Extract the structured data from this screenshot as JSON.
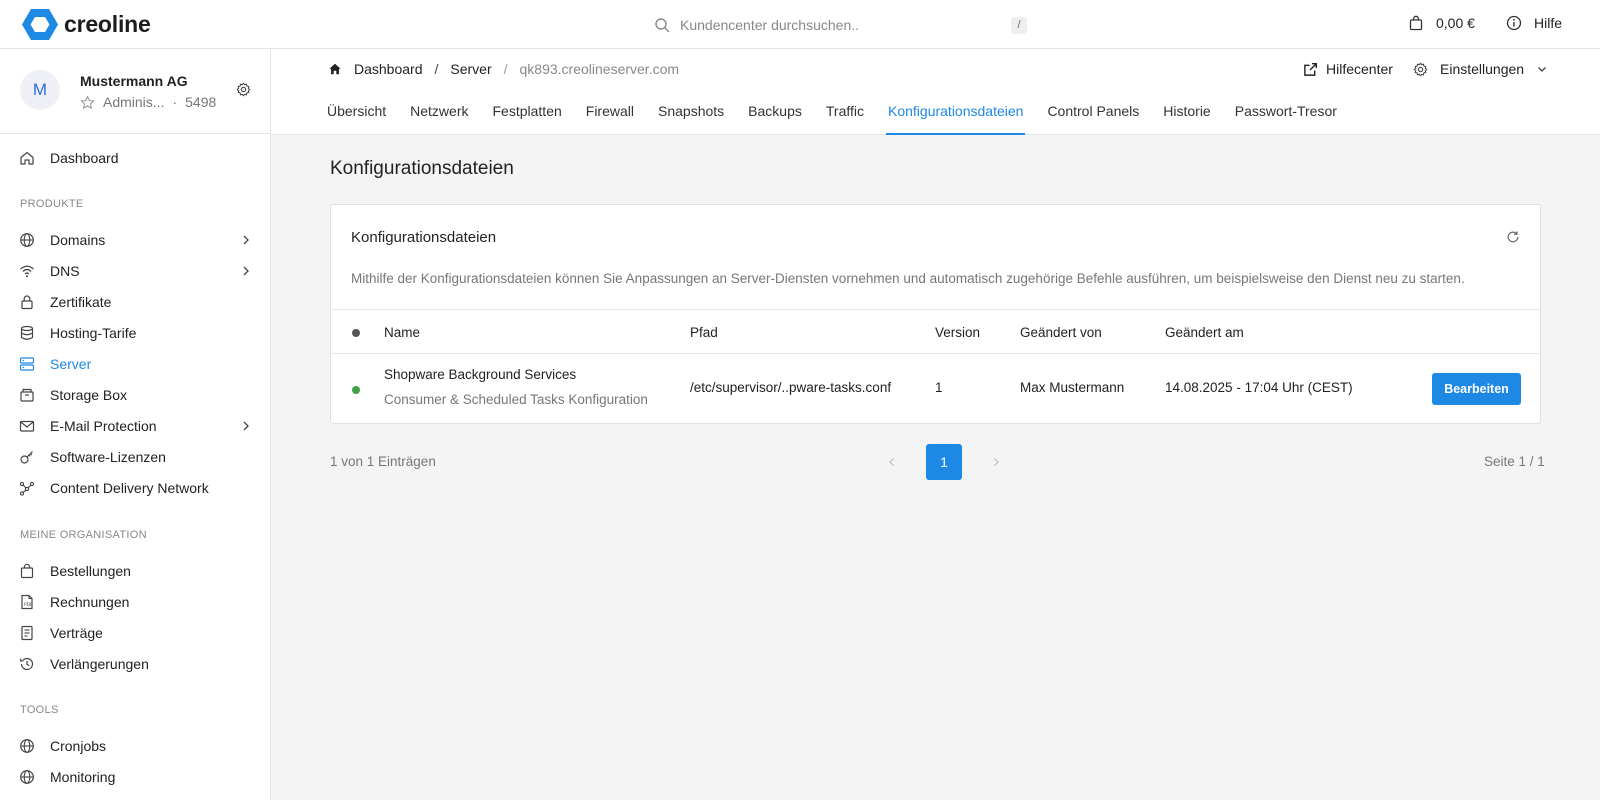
{
  "topbar": {
    "logo_text": "creoline",
    "search_placeholder": "Kundencenter durchsuchen..",
    "search_shortcut": "/",
    "cart_amount": "0,00 €",
    "help_label": "Hilfe"
  },
  "account": {
    "avatar_initial": "M",
    "name": "Mustermann AG",
    "role": "Adminis...",
    "separator": "·",
    "number": "5498"
  },
  "sidebar": {
    "items": [
      {
        "label": "Dashboard",
        "icon": "home-icon"
      },
      {
        "label": "Domains",
        "icon": "globe-icon"
      },
      {
        "label": "DNS",
        "icon": "wifi-icon"
      },
      {
        "label": "Zertifikate",
        "icon": "lock-icon"
      },
      {
        "label": "Hosting-Tarife",
        "icon": "database-icon"
      },
      {
        "label": "Server",
        "icon": "server-icon"
      },
      {
        "label": "Storage Box",
        "icon": "box-icon"
      },
      {
        "label": "E-Mail Protection",
        "icon": "mail-icon"
      },
      {
        "label": "Software-Lizenzen",
        "icon": "license-icon"
      },
      {
        "label": "Content Delivery Network",
        "icon": "network-icon"
      },
      {
        "label": "Bestellungen",
        "icon": "bag-icon"
      },
      {
        "label": "Rechnungen",
        "icon": "invoice-icon"
      },
      {
        "label": "Verträge",
        "icon": "contract-icon"
      },
      {
        "label": "Verlängerungen",
        "icon": "history-icon"
      },
      {
        "label": "Cronjobs",
        "icon": "globe-icon"
      },
      {
        "label": "Monitoring",
        "icon": "globe-icon"
      }
    ],
    "sections": {
      "products": "PRODUKTE",
      "organisation": "MEINE ORGANISATION",
      "tools": "TOOLS"
    }
  },
  "breadcrumb": {
    "home": "Dashboard",
    "sep1": "/",
    "server": "Server",
    "sep2": "/",
    "current": "qk893.creolineserver.com"
  },
  "header": {
    "helpcenter": "Hilfecenter",
    "settings": "Einstellungen"
  },
  "tabs": [
    {
      "label": "Übersicht"
    },
    {
      "label": "Netzwerk"
    },
    {
      "label": "Festplatten"
    },
    {
      "label": "Firewall"
    },
    {
      "label": "Snapshots"
    },
    {
      "label": "Backups"
    },
    {
      "label": "Traffic"
    },
    {
      "label": "Konfigurationsdateien"
    },
    {
      "label": "Control Panels"
    },
    {
      "label": "Historie"
    },
    {
      "label": "Passwort-Tresor"
    }
  ],
  "page": {
    "title": "Konfigurationsdateien"
  },
  "card": {
    "title": "Konfigurationsdateien",
    "description": "Mithilfe der Konfigurationsdateien können Sie Anpassungen an Server-Diensten vornehmen und automatisch zugehörige Befehle ausführen, um beispielsweise den Dienst neu zu starten.",
    "columns": {
      "name": "Name",
      "path": "Pfad",
      "version": "Version",
      "changed_by": "Geändert von",
      "changed_at": "Geändert am"
    },
    "rows": [
      {
        "name": "Shopware Background Services",
        "subtitle": "Consumer & Scheduled Tasks Konfiguration",
        "path": "/etc/supervisor/..pware-tasks.conf",
        "version": "1",
        "changed_by": "Max Mustermann",
        "changed_at": "14.08.2025 - 17:04 Uhr (CEST)",
        "action": "Bearbeiten",
        "status_color": "#43a047"
      }
    ]
  },
  "pagination": {
    "entries": "1 von 1 Einträgen",
    "current_page": "1",
    "page_info": "Seite 1 / 1"
  },
  "colors": {
    "accent": "#1e88e5",
    "status_active": "#43a047"
  }
}
